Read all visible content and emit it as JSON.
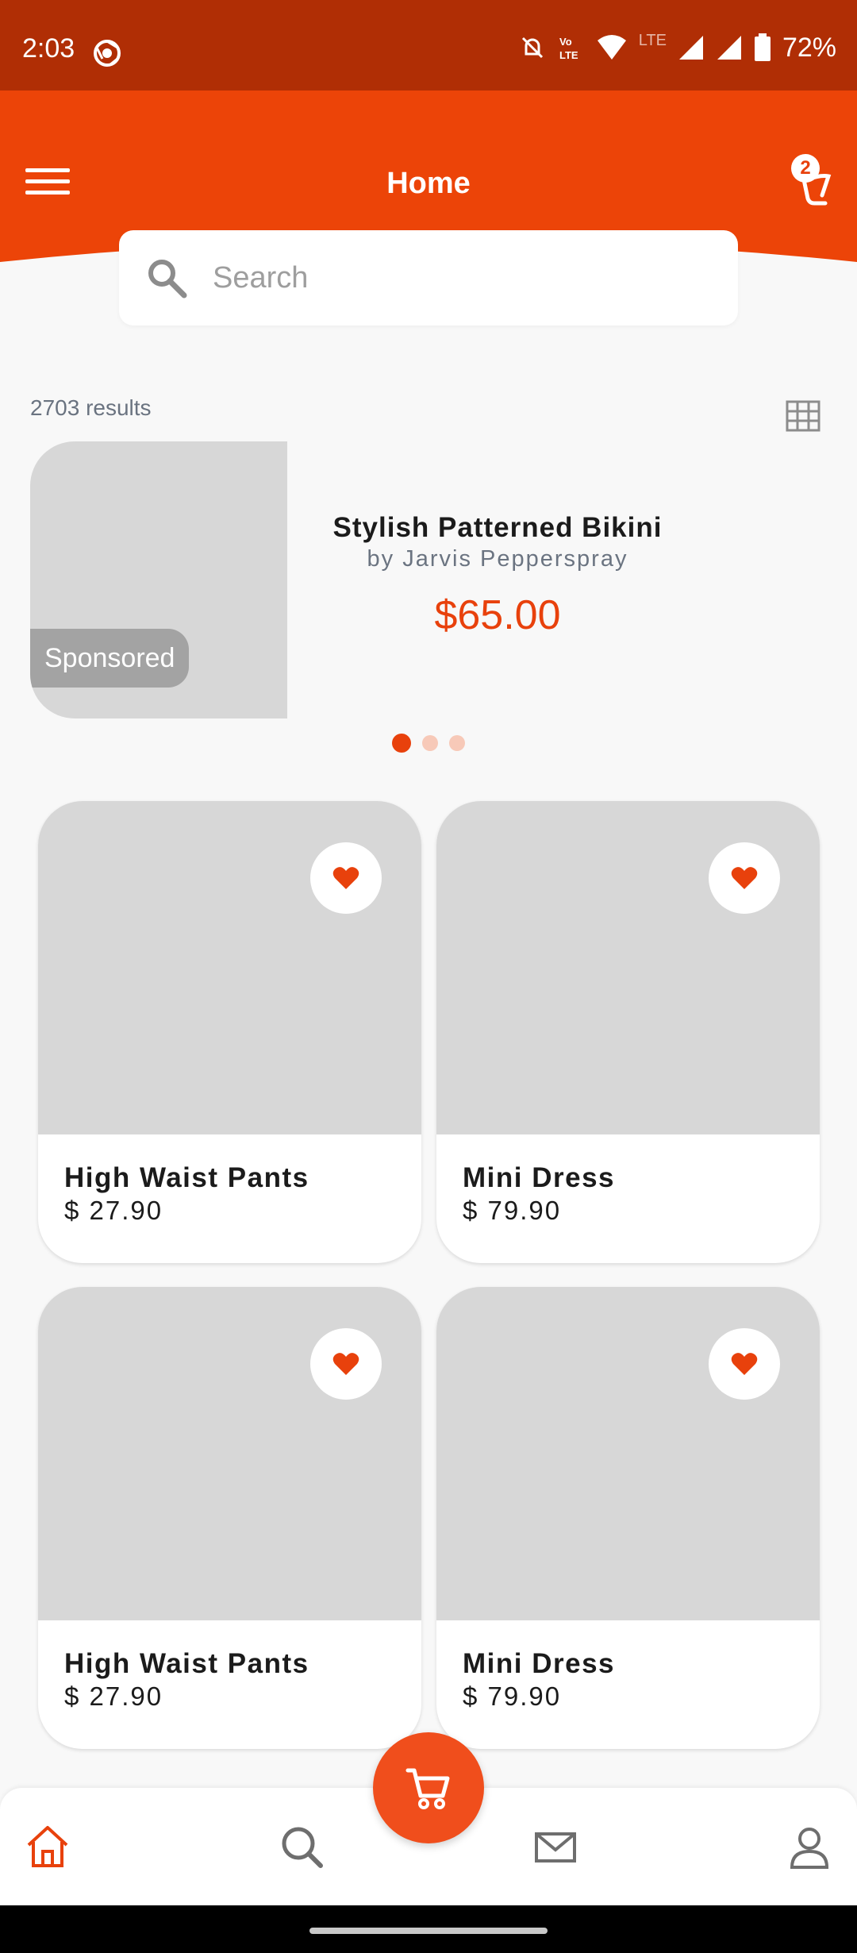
{
  "status_bar": {
    "time": "2:03",
    "battery": "72%",
    "network_label": "LTE"
  },
  "app_bar": {
    "title": "Home",
    "cart_badge": "2",
    "accent_color": "#e8410c"
  },
  "search": {
    "placeholder": "Search"
  },
  "results": {
    "count_label": "2703 results"
  },
  "sponsored": {
    "tag": "Sponsored",
    "title": "Stylish Patterned Bikini",
    "by": "by Jarvis Pepperspray",
    "price": "$65.00",
    "carousel_total": 3,
    "carousel_active": 1
  },
  "products": [
    {
      "name": "High Waist Pants",
      "price": "$ 27.90",
      "favorite": true
    },
    {
      "name": "Mini Dress",
      "price": "$ 79.90",
      "favorite": true
    },
    {
      "name": "High Waist Pants",
      "price": "$ 27.90",
      "favorite": true
    },
    {
      "name": "Mini Dress",
      "price": "$ 79.90",
      "favorite": true
    }
  ],
  "bottom_nav": {
    "items": [
      {
        "icon": "home-icon",
        "active": true
      },
      {
        "icon": "search-icon",
        "active": false
      },
      {
        "icon": "cart-icon",
        "active": false
      },
      {
        "icon": "mail-icon",
        "active": false
      },
      {
        "icon": "profile-icon",
        "active": false
      }
    ]
  }
}
